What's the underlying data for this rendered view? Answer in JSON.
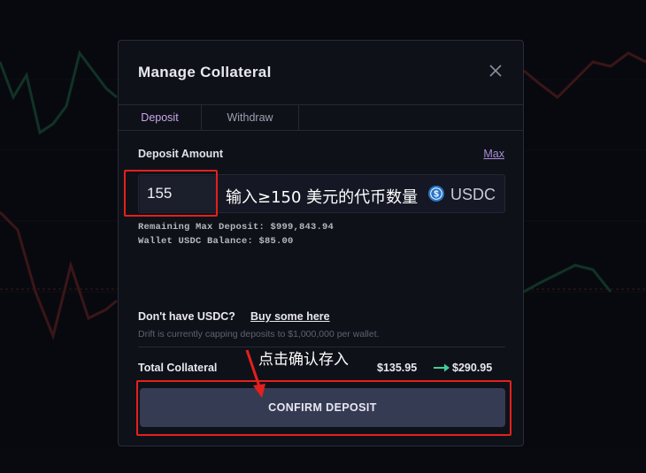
{
  "modal": {
    "title": "Manage Collateral",
    "close_icon": "close-icon"
  },
  "tabs": [
    {
      "label": "Deposit",
      "active": true
    },
    {
      "label": "Withdraw",
      "active": false
    }
  ],
  "deposit": {
    "label": "Deposit Amount",
    "max_label": "Max",
    "amount_value": "155",
    "annotation_hint": "输入≥150 美元的代币数量",
    "token_icon": "usdc-icon",
    "token": "USDC",
    "remaining_max": "Remaining Max Deposit: $999,843.94",
    "wallet_balance": "Wallet USDC Balance: $85.00"
  },
  "buy": {
    "prompt": "Don't have USDC?",
    "link": "Buy some here",
    "note": "Drift is currently capping deposits to $1,000,000 per wallet."
  },
  "total": {
    "label": "Total Collateral",
    "annotation": "点击确认存入",
    "old_value": "$135.95",
    "new_value": "$290.95"
  },
  "confirm_button": "CONFIRM DEPOSIT",
  "colors": {
    "accent": "#c9a8e8",
    "arrow_green": "#3fcf9a",
    "annotation_red": "#e5201c",
    "button_bg": "#363b54"
  }
}
